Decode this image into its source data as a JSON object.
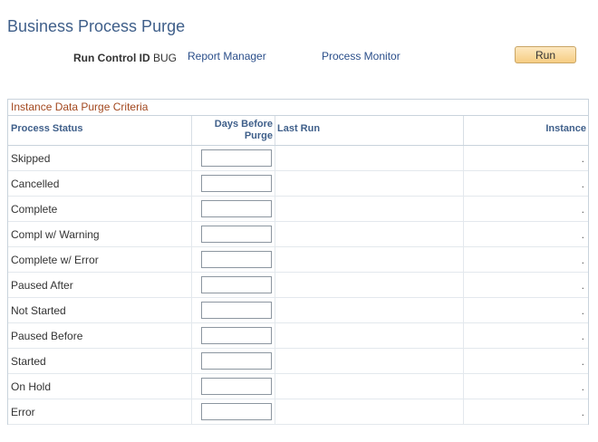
{
  "page": {
    "title": "Business Process Purge"
  },
  "run_control": {
    "label": "Run Control ID",
    "value": "BUG",
    "report_manager_link": "Report Manager",
    "process_monitor_link": "Process Monitor",
    "run_button": "Run"
  },
  "grid": {
    "caption": "Instance Data Purge Criteria",
    "headers": {
      "status": "Process Status",
      "days": "Days Before Purge",
      "last_run": "Last Run",
      "instance": "Instance"
    },
    "rows": [
      {
        "status": "Skipped",
        "days": "",
        "last_run": "",
        "instance": "."
      },
      {
        "status": "Cancelled",
        "days": "",
        "last_run": "",
        "instance": "."
      },
      {
        "status": "Complete",
        "days": "",
        "last_run": "",
        "instance": "."
      },
      {
        "status": "Compl w/ Warning",
        "days": "",
        "last_run": "",
        "instance": "."
      },
      {
        "status": "Complete w/ Error",
        "days": "",
        "last_run": "",
        "instance": "."
      },
      {
        "status": "Paused After",
        "days": "",
        "last_run": "",
        "instance": "."
      },
      {
        "status": "Not Started",
        "days": "",
        "last_run": "",
        "instance": "."
      },
      {
        "status": "Paused Before",
        "days": "",
        "last_run": "",
        "instance": "."
      },
      {
        "status": "Started",
        "days": "",
        "last_run": "",
        "instance": "."
      },
      {
        "status": "On Hold",
        "days": "",
        "last_run": "",
        "instance": "."
      },
      {
        "status": "Error",
        "days": "",
        "last_run": "",
        "instance": "."
      }
    ]
  }
}
